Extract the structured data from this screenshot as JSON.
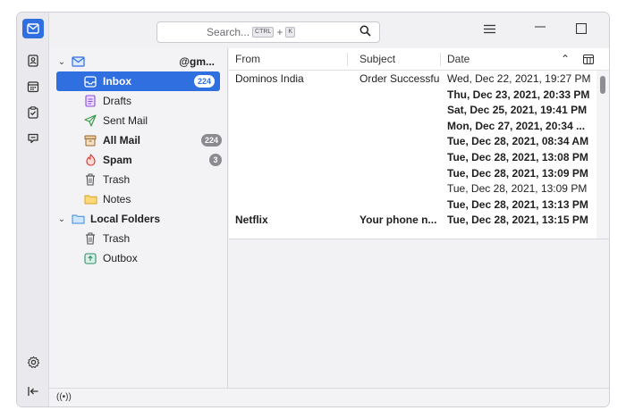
{
  "search": {
    "placeholder": "Search...",
    "kbd_ctrl": "CTRL",
    "plus": "+",
    "kbd_k": "K",
    "icon": "search-icon"
  },
  "titlebar": {
    "menu_icon": "hamburger-icon",
    "minimize_icon": "minimize-icon",
    "maximize_icon": "maximize-icon",
    "close_icon": "close-icon"
  },
  "spaces": [
    {
      "name": "mail",
      "icon": "mail-icon",
      "active": true
    },
    {
      "name": "address-book",
      "icon": "address-book-icon"
    },
    {
      "name": "calendar",
      "icon": "calendar-icon"
    },
    {
      "name": "tasks",
      "icon": "tasks-icon"
    },
    {
      "name": "chat",
      "icon": "chat-icon"
    },
    {
      "name": "settings",
      "icon": "gear-icon"
    },
    {
      "name": "collapse",
      "icon": "collapse-icon"
    }
  ],
  "account": {
    "name": "@gm..."
  },
  "folders": [
    {
      "label": "Inbox",
      "count": "224",
      "selected": true,
      "bold": true
    },
    {
      "label": "Drafts"
    },
    {
      "label": "Sent Mail"
    },
    {
      "label": "All Mail",
      "count": "224",
      "bold": true
    },
    {
      "label": "Spam",
      "count": "3",
      "bold": true
    },
    {
      "label": "Trash"
    },
    {
      "label": "Notes"
    }
  ],
  "local": {
    "label": "Local Folders",
    "items": [
      {
        "label": "Trash"
      },
      {
        "label": "Outbox"
      }
    ]
  },
  "columns": {
    "from": "From",
    "subject": "Subject",
    "date": "Date",
    "sort_icon": "chevron-up-icon",
    "picker_icon": "column-picker-icon"
  },
  "messages": [
    {
      "from": "Dominos India",
      "subject": "Order Successful",
      "date": "Wed, Dec 22, 2021, 19:27 PM",
      "bold": false
    },
    {
      "from": "",
      "subject": "",
      "date": "Thu, Dec 23, 2021, 20:33 PM",
      "bold": true
    },
    {
      "from": "",
      "subject": "",
      "date": "Sat, Dec 25, 2021, 19:41 PM",
      "bold": true
    },
    {
      "from": "",
      "subject": "",
      "date": "Mon, Dec 27, 2021, 20:34 ...",
      "bold": true
    },
    {
      "from": "",
      "subject": "",
      "date": "Tue, Dec 28, 2021, 08:34 AM",
      "bold": true
    },
    {
      "from": "",
      "subject": "",
      "date": "Tue, Dec 28, 2021, 13:08 PM",
      "bold": true
    },
    {
      "from": "",
      "subject": "",
      "date": "Tue, Dec 28, 2021, 13:09 PM",
      "bold": true
    },
    {
      "from": "",
      "subject": "",
      "date": "Tue, Dec 28, 2021, 13:09 PM",
      "bold": false
    },
    {
      "from": "",
      "subject": "",
      "date": "Tue, Dec 28, 2021, 13:13 PM",
      "bold": true
    },
    {
      "from": "Netflix",
      "subject": "Your phone n...",
      "date": "Tue, Dec 28, 2021, 13:15 PM",
      "bold": true
    }
  ],
  "status": {
    "icon": "connection-icon",
    "text": "((•))"
  },
  "colors": {
    "accent": "#2f6fe0",
    "sidebar": "#eaeaee",
    "pane": "#f3f3f6",
    "preview": "#f2f2f4"
  }
}
